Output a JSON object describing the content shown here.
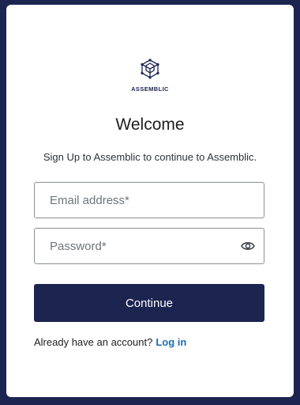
{
  "logo": {
    "text": "ASSEMBLIC",
    "icon": "cube-network-icon"
  },
  "heading": {
    "title": "Welcome",
    "subtitle": "Sign Up to Assemblic to continue to Assemblic."
  },
  "form": {
    "email_placeholder": "Email address*",
    "password_placeholder": "Password*",
    "show_password_icon": "eye-icon",
    "continue_label": "Continue"
  },
  "footer": {
    "prompt": "Already have an account?",
    "login_link": "Log in"
  },
  "colors": {
    "brand": "#1c2550",
    "link": "#1b6fb0",
    "field_border": "#8b8f95"
  }
}
